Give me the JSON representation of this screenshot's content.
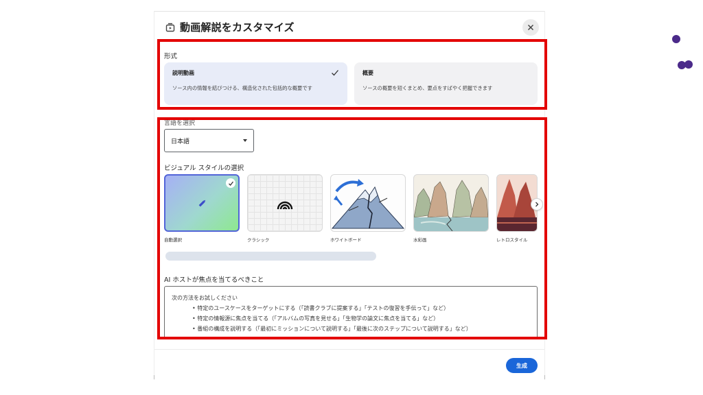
{
  "dialog": {
    "title": "動画解説をカスタマイズ",
    "format_label": "形式",
    "format_options": [
      {
        "title": "説明動画",
        "description": "ソース内の情報を結びつける、構造化された包括的な概要です",
        "selected": true
      },
      {
        "title": "概要",
        "description": "ソースの概要を短くまとめ、要点をすばやく把握できます",
        "selected": false
      }
    ],
    "language_label": "言語を選択",
    "language_value": "日本語",
    "visual_style_label": "ビジュアル スタイルの選択",
    "styles": [
      {
        "label": "自動選択",
        "selected": true
      },
      {
        "label": "クラシック",
        "selected": false
      },
      {
        "label": "ホワイトボード",
        "selected": false
      },
      {
        "label": "水彩画",
        "selected": false
      },
      {
        "label": "レトロスタイル",
        "selected": false
      }
    ],
    "focus_label": "AI ホストが焦点を当てるべきこと",
    "focus_intro": "次の方法をお試しください",
    "focus_bullets": [
      "• 特定のユースケースをターゲットにする（「読書クラブに提案する」「テストの復習を手伝って」など）",
      "• 特定の情報源に焦点を当てる（「アルバムの写真を見せる」「生物学の論文に焦点を当てる」など）",
      "• 番組の構成を説明する（「最初にミッションについて説明する」「最後に次のステップについて説明する」など）"
    ],
    "generate_label": "生成"
  },
  "colors": {
    "accent": "#1a66d9",
    "annotation": "#e30000",
    "selected_card": "#e8ecf8",
    "dots": "#4b2a8a"
  },
  "icons": {
    "title_icon": "video-overview-icon",
    "close": "close-icon",
    "check": "check-icon",
    "next": "chevron-right-icon",
    "dropdown": "caret-down-icon"
  }
}
